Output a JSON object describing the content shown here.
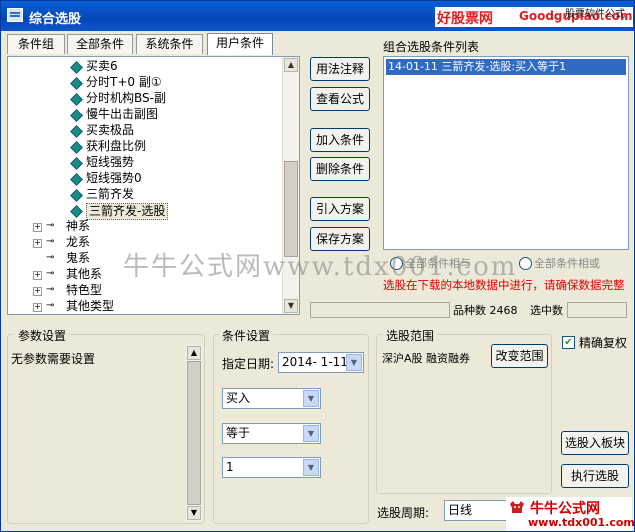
{
  "window": {
    "title": "综合选股"
  },
  "watermark_top": {
    "a": "好股票网",
    "b": "Goodgupiao.com",
    "c": "股票软件公式"
  },
  "tabs": [
    {
      "label": "条件组"
    },
    {
      "label": "全部条件"
    },
    {
      "label": "系统条件"
    },
    {
      "label": "用户条件",
      "active": true
    }
  ],
  "tree": {
    "leaves": [
      "买卖6",
      "分时T+0 副①",
      "分时机构BS-副",
      "慢牛出击副图",
      "买卖极品",
      "获利盘比例",
      "短线强势",
      "短线强势0",
      "三箭齐发",
      "三箭齐发-选股"
    ],
    "groups": [
      "神系",
      "龙系",
      "鬼系",
      "其他系",
      "特色型",
      "其他类型"
    ]
  },
  "action_buttons": {
    "usage": "用法注释",
    "view_formula": "查看公式",
    "add_condition": "加入条件",
    "delete_condition": "删除条件",
    "import_plan": "引入方案",
    "save_plan": "保存方案"
  },
  "condition_list": {
    "title": "组合选股条件列表",
    "items": [
      "14-01-11 三箭齐发-选股:买入等于1"
    ]
  },
  "logic": {
    "and_label": "全部条件相与",
    "or_label": "全部条件相或"
  },
  "warning": "选股在下载的本地数据中进行，请确保数据完整",
  "status": {
    "count_label": "品种数",
    "count_value": "2468",
    "selected_label": "选中数"
  },
  "params": {
    "title": "参数设置",
    "text": "无参数需要设置"
  },
  "cond_settings": {
    "title": "条件设置",
    "date_label": "指定日期:",
    "date_value": "2014- 1-11",
    "action": "买入",
    "op": "等于",
    "value": "1"
  },
  "range": {
    "title": "选股范围",
    "text": "深沪A股 融资融券",
    "change_button": "改变范围"
  },
  "exact_restore": {
    "label": "精确复权",
    "checked": true
  },
  "to_block_button": "选股入板块",
  "run_button": "执行选股",
  "period": {
    "label": "选股周期:",
    "value": "日线"
  },
  "overlay_watermark": "牛牛公式网www.tdx001.com",
  "bottom_watermark": {
    "a": "牛牛公式网",
    "b": "www.tdx001.com"
  }
}
